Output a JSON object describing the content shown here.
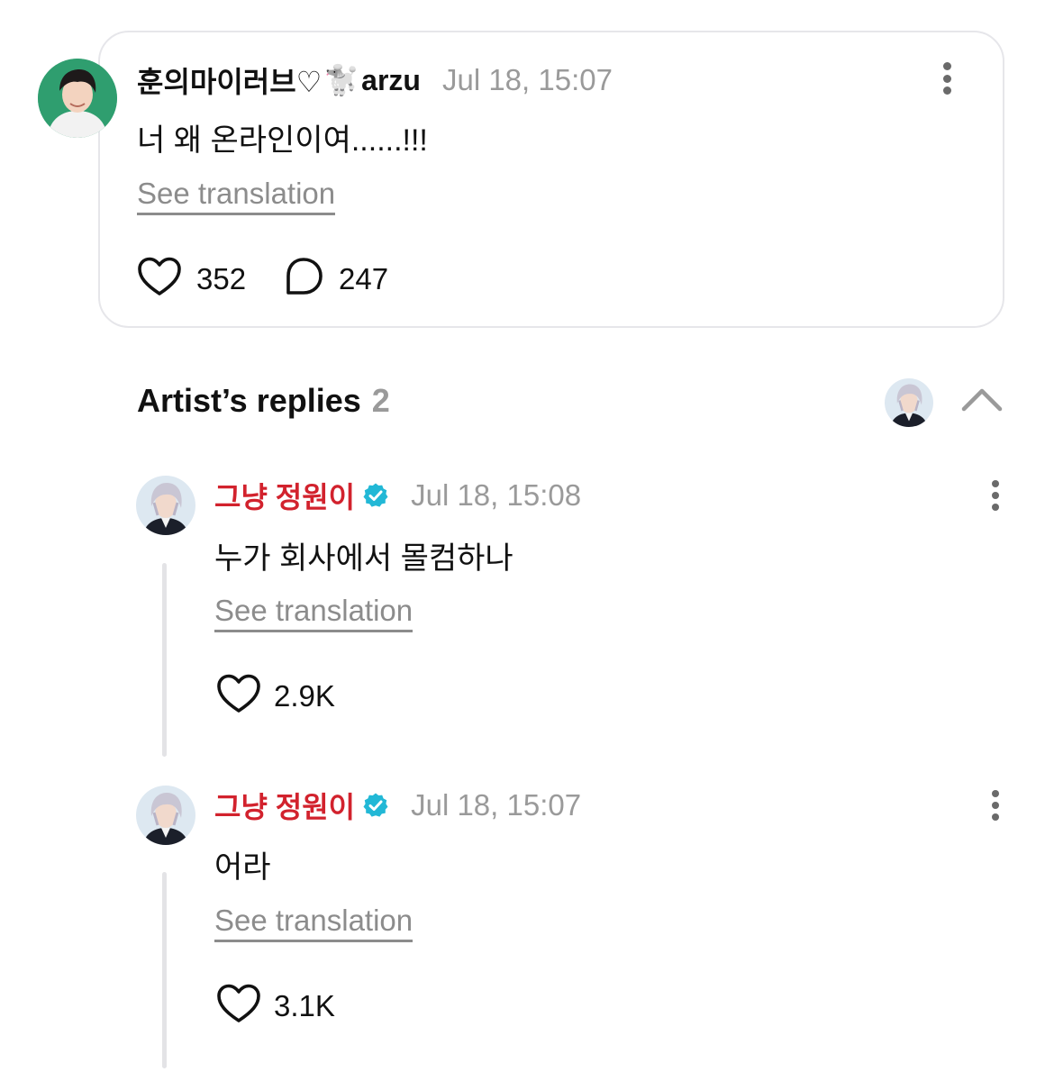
{
  "post": {
    "author": "훈의마이러브♡",
    "author_emoji": "🐩",
    "author_suffix": "arzu",
    "timestamp": "Jul 18, 15:07",
    "text": "너 왜 온라인이여......!!!",
    "translation_link": "See translation",
    "likes": "352",
    "replies": "247",
    "icons": {
      "more": "more-vertical-icon",
      "like": "heart-icon",
      "reply": "comment-bubble-icon"
    }
  },
  "artist_replies": {
    "title": "Artist’s replies",
    "count": "2",
    "collapse_icon": "chevron-up-icon"
  },
  "replies": [
    {
      "author": "그냥 정원이",
      "verified": true,
      "timestamp": "Jul 18, 15:08",
      "text": "누가 회사에서 몰컴하나",
      "translation_link": "See translation",
      "likes": "2.9K"
    },
    {
      "author": "그냥 정원이",
      "verified": true,
      "timestamp": "Jul 18, 15:07",
      "text": "어라",
      "translation_link": "See translation",
      "likes": "3.1K"
    }
  ],
  "colors": {
    "artist_name": "#d2222d",
    "verified_badge": "#22b8d6",
    "muted_text": "#9a9a9a",
    "card_border": "#e6e6ea"
  }
}
